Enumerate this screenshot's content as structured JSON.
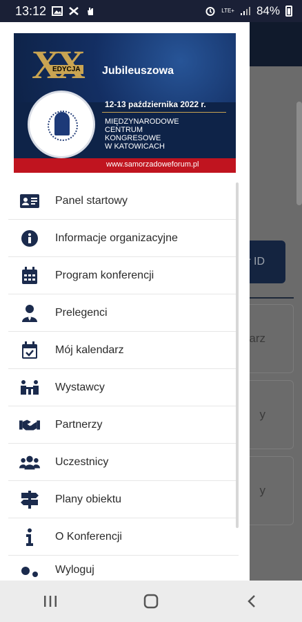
{
  "status_bar": {
    "time": "13:12",
    "lte": "LTE+",
    "battery": "84%"
  },
  "banner": {
    "roman": "XX",
    "edition": "EDYCJA",
    "subtitle": "Jubileuszowa",
    "date": "12-13 października 2022 r.",
    "venue_lines": [
      "MIĘDZYNARODOWE",
      "CENTRUM",
      "KONGRESOWE",
      "W KATOWICACH"
    ],
    "url": "www.samorzadoweforum.pl"
  },
  "menu": {
    "items": [
      {
        "label": "Panel startowy",
        "icon": "id-card-icon"
      },
      {
        "label": "Informacje organizacyjne",
        "icon": "info-circle-icon"
      },
      {
        "label": "Program konferencji",
        "icon": "calendar-icon"
      },
      {
        "label": "Prelegenci",
        "icon": "speaker-icon"
      },
      {
        "label": "Mój kalendarz",
        "icon": "calendar-check-icon"
      },
      {
        "label": "Wystawcy",
        "icon": "exhibitors-icon"
      },
      {
        "label": "Partnerzy",
        "icon": "handshake-icon"
      },
      {
        "label": "Uczestnicy",
        "icon": "users-icon"
      },
      {
        "label": "Plany obiektu",
        "icon": "signpost-icon"
      },
      {
        "label": "O Konferencji",
        "icon": "info-icon"
      },
      {
        "label": "Wyloguj",
        "icon": "logout-icon"
      }
    ]
  },
  "background": {
    "button_label": "r ID",
    "card_1": "darz",
    "card_2": "y",
    "card_3": "y"
  },
  "colors": {
    "status_bar": "#1a2036",
    "icon": "#1b2b4d",
    "banner_red": "#c0141f",
    "banner_gold": "#c9a452"
  }
}
